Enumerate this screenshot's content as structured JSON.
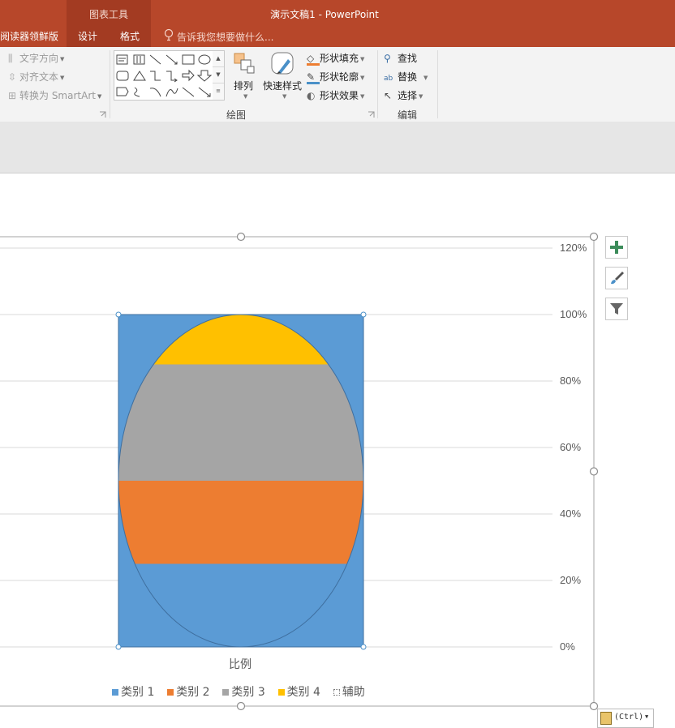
{
  "window": {
    "tool_context_label": "图表工具",
    "document_title": "演示文稿1 - PowerPoint"
  },
  "ribbon_tabs": {
    "reader": "阅读器领鲜版",
    "design": "设计",
    "format": "格式",
    "tell_me": "告诉我您想要做什么..."
  },
  "ribbon": {
    "paragraph": {
      "text_direction": "文字方向",
      "align_text": "对齐文本",
      "convert_smartart": "转换为 SmartArt"
    },
    "drawing": {
      "arrange": "排列",
      "quick_styles": "快速样式",
      "shape_fill": "形状填充",
      "shape_outline": "形状轮廓",
      "shape_effects": "形状效果",
      "group_label": "绘图"
    },
    "editing": {
      "find": "查找",
      "replace": "替换",
      "select": "选择",
      "group_label": "编辑"
    }
  },
  "chart_data": {
    "type": "bar",
    "stacked": true,
    "categories": [
      "比例"
    ],
    "series": [
      {
        "name": "类别 1",
        "values": [
          0.25
        ],
        "color": "#ed7d31"
      },
      {
        "name": "类别 2",
        "values": [
          0.25
        ],
        "color": "#ed7d31"
      },
      {
        "name": "类别 3",
        "values": [
          0.35
        ],
        "color": "#a5a5a5"
      },
      {
        "name": "类别 4",
        "values": [
          0.15
        ],
        "color": "#ffc000"
      },
      {
        "name": "辅助",
        "values": [
          1.0
        ],
        "color": "#5b9bd5"
      }
    ],
    "legend": [
      {
        "name": "类别 1",
        "color": "#5b9bd5"
      },
      {
        "name": "类别 2",
        "color": "#ed7d31"
      },
      {
        "name": "类别 3",
        "color": "#a5a5a5"
      },
      {
        "name": "类别 4",
        "color": "#ffc000"
      },
      {
        "name": "辅助",
        "color": "none"
      }
    ],
    "ylim": [
      0,
      1.2
    ],
    "yticks": [
      "0%",
      "20%",
      "40%",
      "60%",
      "80%",
      "100%",
      "120%"
    ],
    "y_axis_position": "right",
    "grid": true,
    "legend_position": "bottom"
  },
  "paste_options": {
    "label": "(Ctrl)"
  },
  "colors": {
    "title_bar": "#b7472a",
    "accent_blue": "#5b9bd5",
    "accent_orange": "#ed7d31",
    "accent_gray": "#a5a5a5",
    "accent_gold": "#ffc000"
  }
}
